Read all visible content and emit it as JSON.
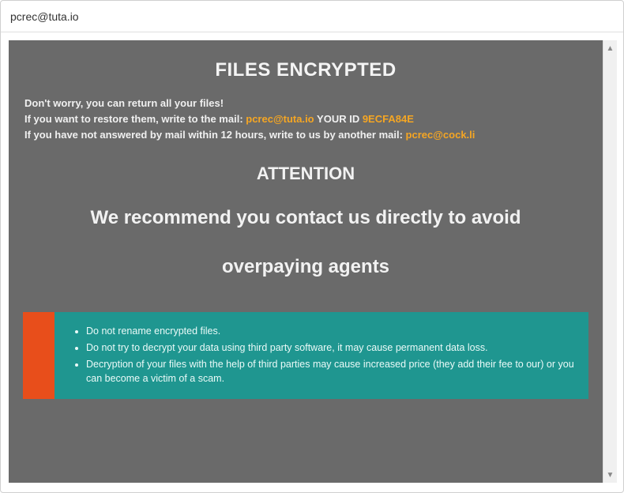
{
  "window": {
    "title": "pcrec@tuta.io"
  },
  "headings": {
    "title": "FILES ENCRYPTED",
    "attention": "ATTENTION",
    "recommend_line1": "We recommend you contact us directly to avoid",
    "recommend_line2": "overpaying agents"
  },
  "intro": {
    "line1": "Don't worry, you can return all your files!",
    "line2_prefix": "If you want to restore them, write to the mail:  ",
    "email1": "pcrec@tuta.io",
    "id_label": "   YOUR ID ",
    "id_value": "9ECFA84E",
    "line3_prefix": "If you have not answered by mail within 12 hours, write to us by another mail:  ",
    "email2": "pcrec@cock.li"
  },
  "warnings": {
    "items": [
      "Do not rename encrypted files.",
      "Do not try to decrypt your data using third party software, it may cause permanent data loss.",
      "Decryption of your files with the help of third parties may cause increased price (they add their fee to our) or you can become a victim of a scam."
    ]
  },
  "scroll": {
    "up": "▲",
    "down": "▼"
  }
}
